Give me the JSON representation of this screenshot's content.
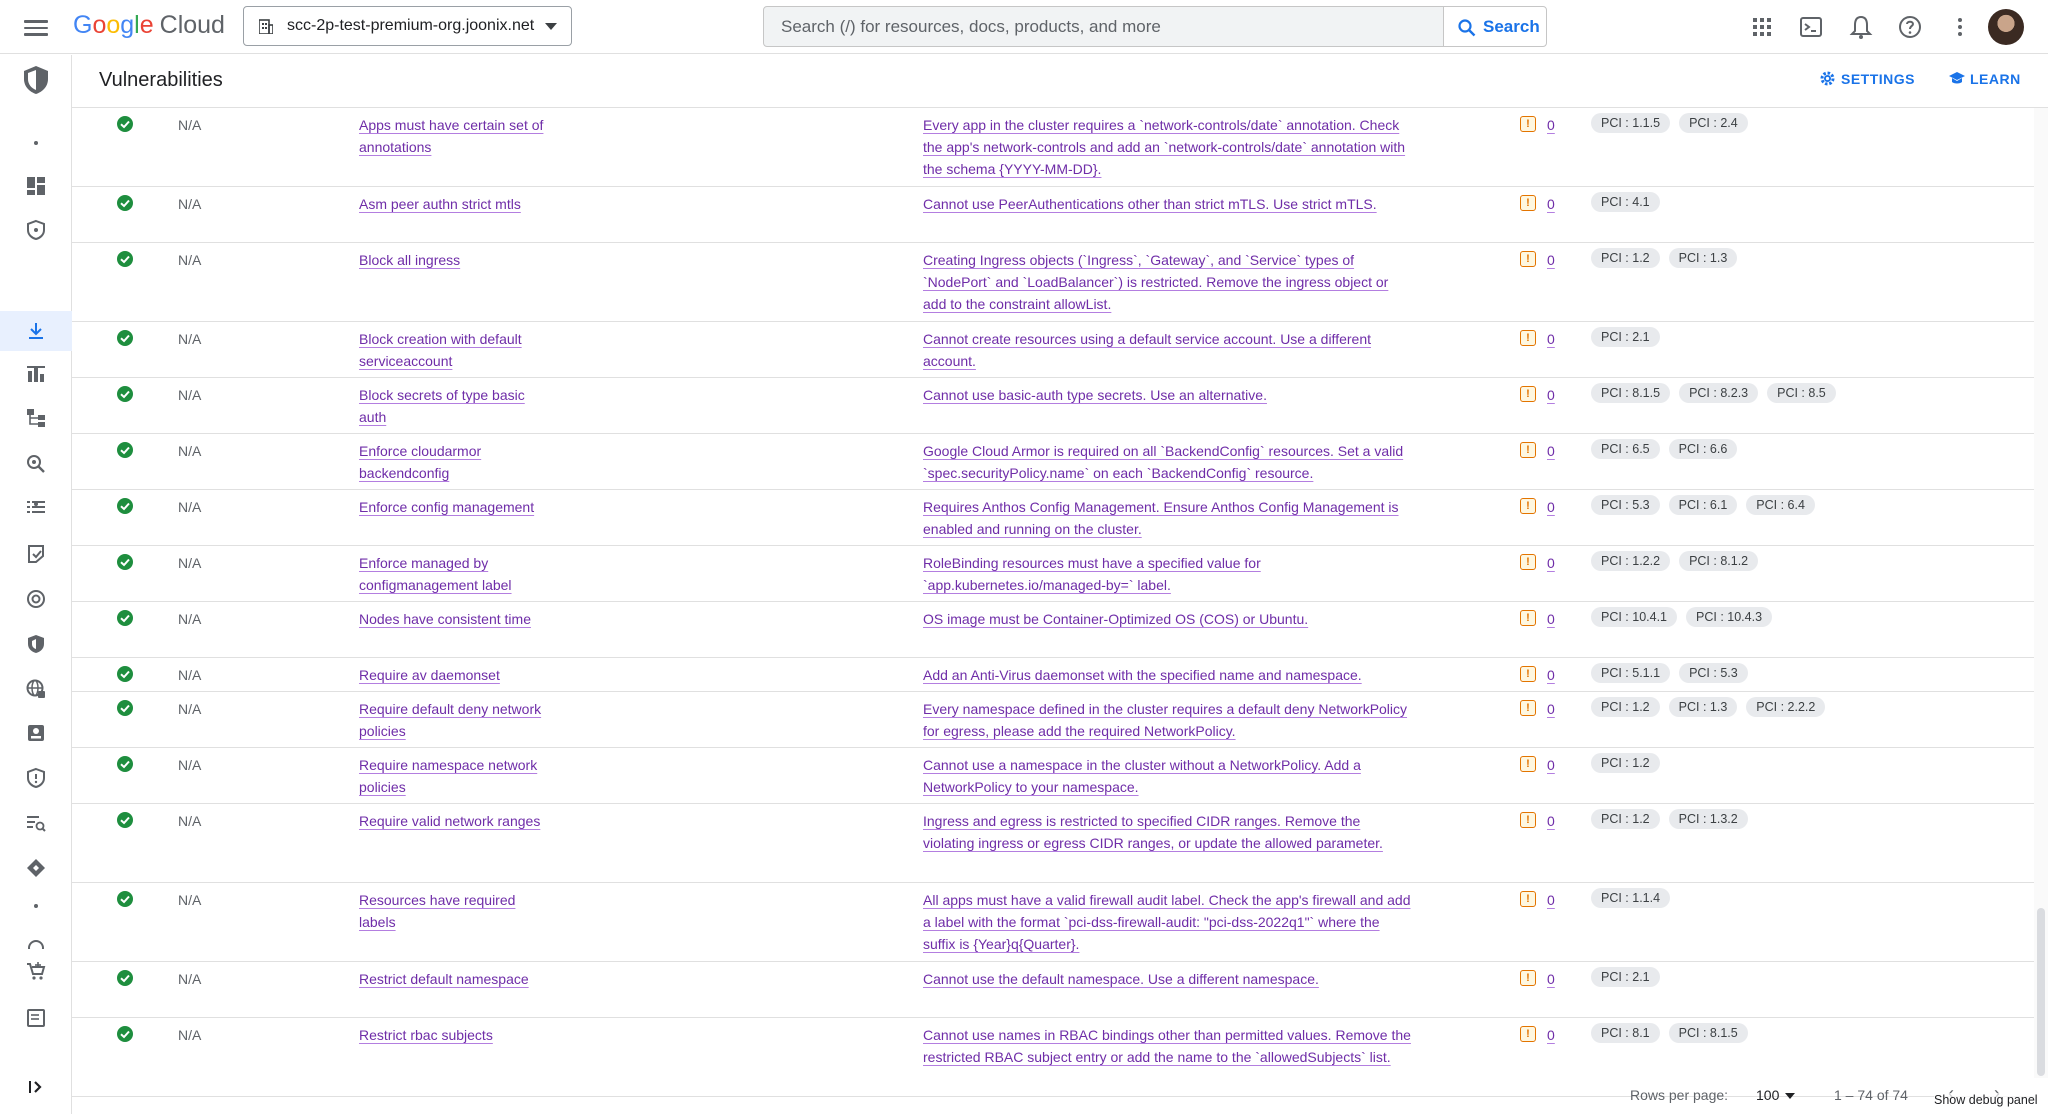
{
  "topbar": {
    "logo_google": "Google",
    "logo_cloud": "Cloud",
    "project": "scc-2p-test-premium-org.joonix.net",
    "search_placeholder": "Search (/) for resources, docs, products, and more",
    "search_button": "Search",
    "icons": [
      "apps-icon",
      "cloud-shell-icon",
      "notifications-icon",
      "help-icon",
      "more-vert-icon"
    ]
  },
  "header": {
    "title": "Vulnerabilities",
    "settings": "SETTINGS",
    "learn": "LEARN"
  },
  "colors": {
    "accent": "#1a73e8",
    "link": "#6f2da8",
    "ok": "#1e8e3e",
    "warn": "#e37400"
  },
  "rows": [
    {
      "status": "N/A",
      "name": "Apps must have certain set of annotations",
      "desc": "Every app in the cluster requires a `network-controls/date` annotation. Check the app's network-controls and add an `network-controls/date` annotation with the schema {YYYY-MM-DD}.",
      "count": "0",
      "chips": [
        "PCI : 1.1.5",
        "PCI : 2.4"
      ]
    },
    {
      "status": "N/A",
      "name": "Asm peer authn strict mtls",
      "desc": "Cannot use PeerAuthentications other than strict mTLS. Use strict mTLS.",
      "count": "0",
      "chips": [
        "PCI : 4.1"
      ]
    },
    {
      "status": "N/A",
      "name": "Block all ingress",
      "desc": "Creating Ingress objects (`Ingress`, `Gateway`, and `Service` types of `NodePort` and `LoadBalancer`) is restricted. Remove the ingress object or add to the constraint allowList.",
      "count": "0",
      "chips": [
        "PCI : 1.2",
        "PCI : 1.3"
      ]
    },
    {
      "status": "N/A",
      "name": "Block creation with default serviceaccount",
      "desc": "Cannot create resources using a default service account. Use a different account.",
      "count": "0",
      "chips": [
        "PCI : 2.1"
      ]
    },
    {
      "status": "N/A",
      "name": "Block secrets of type basic auth",
      "desc": "Cannot use basic-auth type secrets. Use an alternative.",
      "count": "0",
      "chips": [
        "PCI : 8.1.5",
        "PCI : 8.2.3",
        "PCI : 8.5"
      ]
    },
    {
      "status": "N/A",
      "name": "Enforce cloudarmor backendconfig",
      "desc": "Google Cloud Armor is required on all `BackendConfig` resources. Set a valid `spec.securityPolicy.name` on each `BackendConfig` resource.",
      "count": "0",
      "chips": [
        "PCI : 6.5",
        "PCI : 6.6"
      ]
    },
    {
      "status": "N/A",
      "name": "Enforce config management",
      "desc": "Requires Anthos Config Management. Ensure Anthos Config Management is enabled and running on the cluster.",
      "count": "0",
      "chips": [
        "PCI : 5.3",
        "PCI : 6.1",
        "PCI : 6.4"
      ]
    },
    {
      "status": "N/A",
      "name": "Enforce managed by configmanagement label",
      "desc": "RoleBinding resources must have a specified value for `app.kubernetes.io/managed-by=` label.",
      "count": "0",
      "chips": [
        "PCI : 1.2.2",
        "PCI : 8.1.2"
      ]
    },
    {
      "status": "N/A",
      "name": "Nodes have consistent time",
      "desc": "OS image must be Container-Optimized OS (COS) or Ubuntu.",
      "count": "0",
      "chips": [
        "PCI : 10.4.1",
        "PCI : 10.4.3"
      ]
    },
    {
      "status": "N/A",
      "name": "Require av daemonset",
      "desc": "Add an Anti-Virus daemonset with the specified name and namespace.",
      "count": "0",
      "chips": [
        "PCI : 5.1.1",
        "PCI : 5.3"
      ]
    },
    {
      "status": "N/A",
      "name": "Require default deny network policies",
      "desc": "Every namespace defined in the cluster requires a default deny NetworkPolicy for egress, please add the required NetworkPolicy.",
      "count": "0",
      "chips": [
        "PCI : 1.2",
        "PCI : 1.3",
        "PCI : 2.2.2"
      ]
    },
    {
      "status": "N/A",
      "name": "Require namespace network policies",
      "desc": "Cannot use a namespace in the cluster without a NetworkPolicy. Add a NetworkPolicy to your namespace.",
      "count": "0",
      "chips": [
        "PCI : 1.2"
      ]
    },
    {
      "status": "N/A",
      "name": "Require valid network ranges",
      "desc": "Ingress and egress is restricted to specified CIDR ranges. Remove the violating ingress or egress CIDR ranges, or update the allowed parameter.",
      "count": "0",
      "chips": [
        "PCI : 1.2",
        "PCI : 1.3.2"
      ]
    },
    {
      "status": "N/A",
      "name": "Resources have required labels",
      "desc": "All apps must have a valid firewall audit label. Check the app's firewall and add a label with the format `pci-dss-firewall-audit: \"pci-dss-2022q1\"` where the suffix is {Year}q{Quarter}.",
      "count": "0",
      "chips": [
        "PCI : 1.1.4"
      ]
    },
    {
      "status": "N/A",
      "name": "Restrict default namespace",
      "desc": "Cannot use the default namespace. Use a different namespace.",
      "count": "0",
      "chips": [
        "PCI : 2.1"
      ]
    },
    {
      "status": "N/A",
      "name": "Restrict rbac subjects",
      "desc": "Cannot use names in RBAC bindings other than permitted values. Remove the restricted RBAC subject entry or add the name to the `allowedSubjects` list.",
      "count": "0",
      "chips": [
        "PCI : 8.1",
        "PCI : 8.1.5"
      ]
    }
  ],
  "footer": {
    "rows_per_page_label": "Rows per page:",
    "rows_per_page_value": "100",
    "range": "1 – 74 of 74",
    "debug": "Show debug panel"
  }
}
